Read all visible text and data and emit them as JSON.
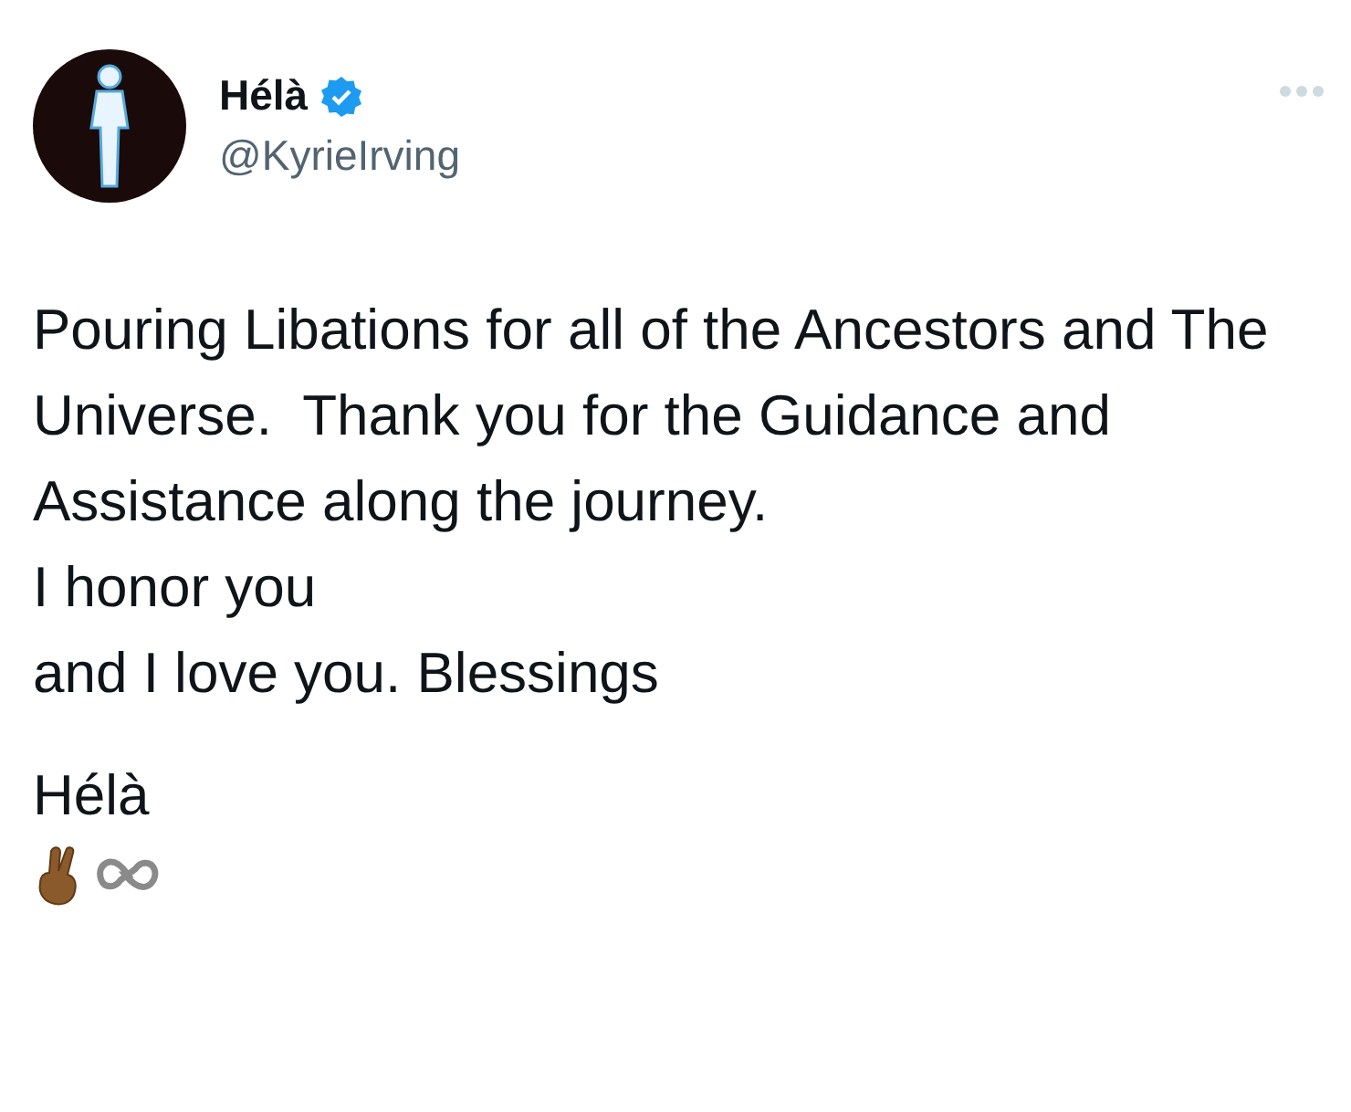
{
  "author": {
    "name": "Hélà",
    "verified": true,
    "handle": "@KyrieIrving"
  },
  "tweet": {
    "text": "Pouring Libations for all of the Ancestors and The Universe.  Thank you for the Guidance and Assistance along the journey.\nI honor you\nand I love you. Blessings",
    "signature": "Hélà"
  }
}
